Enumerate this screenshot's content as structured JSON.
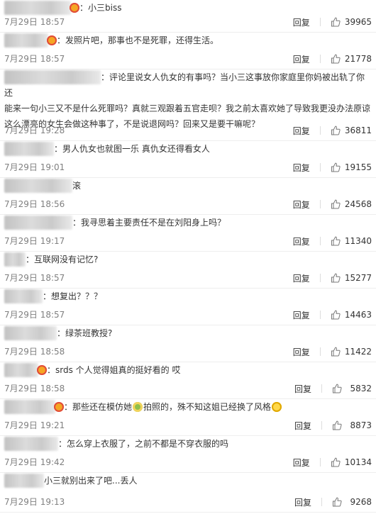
{
  "reply_label": "回复",
  "comments": [
    {
      "text": "：小三biss",
      "time": "7月29日 18:57",
      "likes": "39965",
      "badge": true
    },
    {
      "text": "：发照片吧，那事也不是死罪，还得生活。",
      "time": "7月29日 18:57",
      "likes": "21778",
      "badge": true
    },
    {
      "lines": [
        "：评论里说女人仇女的有事吗？当小三这事放你家庭里你妈被出轨了你还",
        "能来一句小三又不是什么死罪吗？真就三观跟着五官走呗？我之前太喜欢她了导致我更没办法原谅",
        "这么漂亮的女生会做这种事了，不是说退网吗？回来又是要干嘛呢？"
      ],
      "time": "7月29日 19:28",
      "likes": "36811",
      "badge": false
    },
    {
      "text": "：男人仇女也就图一乐 真仇女还得看女人",
      "time": "7月29日 19:01",
      "likes": "19155",
      "badge": false
    },
    {
      "text": "滚",
      "time": "7月29日 18:56",
      "likes": "24568",
      "badge": false
    },
    {
      "text": "：我寻思着主要责任不是在刘阳身上吗？",
      "time": "7月29日 19:17",
      "likes": "11340",
      "badge": false
    },
    {
      "text": "：互联网没有记忆?",
      "time": "7月29日 18:57",
      "likes": "15277",
      "badge": false
    },
    {
      "text": "：想复出？？？",
      "time": "7月29日 18:57",
      "likes": "14463",
      "badge": false
    },
    {
      "text": "：绿茶班教授?",
      "time": "7月29日 18:58",
      "likes": "11422",
      "badge": false
    },
    {
      "text": "：srds 个人觉得姐真的挺好看的 哎",
      "time": "7月29日 18:58",
      "likes": "5832",
      "badge": true
    },
    {
      "text_a": "：那些还在模仿她",
      "text_b": "拍照的，殊不知这姐已经换了风格",
      "time": "7月29日 19:21",
      "likes": "8873",
      "badge": true
    },
    {
      "text": "：怎么穿上衣服了，之前不都是不穿衣服的吗",
      "time": "7月29日 19:42",
      "likes": "10134",
      "badge": false
    },
    {
      "text": "小三就别出来了吧...丢人",
      "time": "7月29日 19:13",
      "likes": "9268",
      "badge": false
    }
  ]
}
